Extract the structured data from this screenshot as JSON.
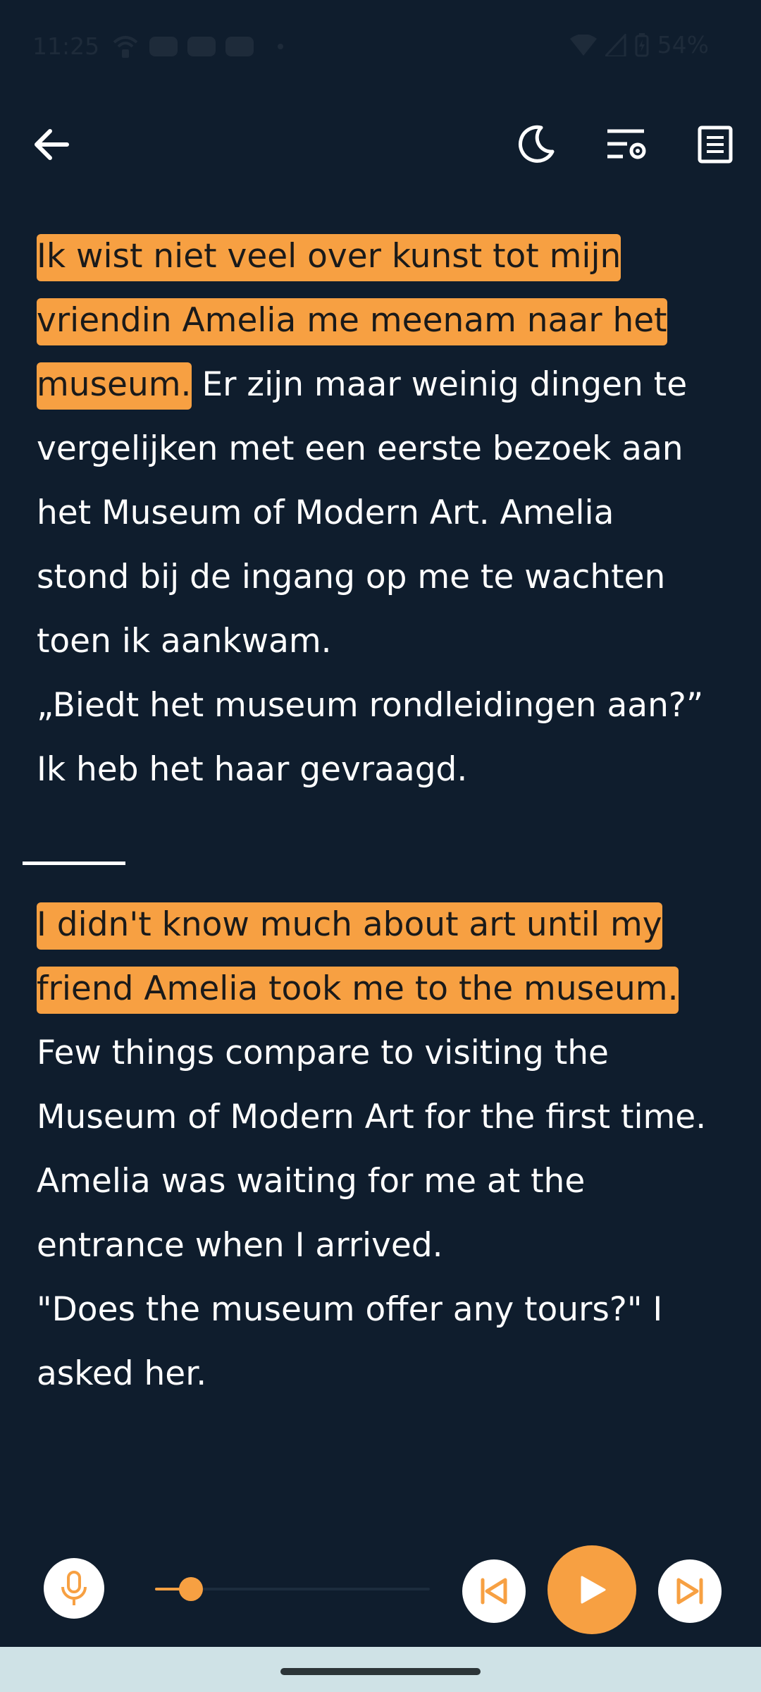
{
  "status_bar": {
    "time": "11:25",
    "battery": "54%",
    "icons": [
      "wifi-calling-icon",
      "youtube-icon",
      "youtube-icon",
      "youtube-icon",
      "notification-dot-icon",
      "wifi-icon",
      "signal-icon",
      "battery-icon"
    ]
  },
  "toolbar": {
    "icons": [
      "back-arrow-icon",
      "night-mode-moon-icon",
      "playback-settings-icon",
      "document-icon"
    ]
  },
  "text": {
    "dutch": {
      "highlighted": "Ik wist niet veel over kunst tot mijn vriendin Amelia me meenam naar het museum.",
      "rest": "Er zijn maar weinig dingen te vergelijken met een eerste bezoek aan het Museum of Modern Art.  Amelia stond bij de ingang op me te wachten toen ik aankwam.",
      "quote": "„Biedt het museum rondleidingen aan?” Ik heb het haar gevraagd."
    },
    "english": {
      "highlighted": "I didn't know much about art until my friend Amelia took me to the museum.",
      "rest": "Few things compare to visiting the Museum of Modern Art for the first time.  Amelia was waiting for me at the entrance when I arrived.",
      "quote": "\"Does the museum offer any tours?\" I asked her."
    }
  },
  "player": {
    "progress": 0.13,
    "icons": [
      "microphone-icon",
      "previous-sentence-icon",
      "play-icon",
      "next-sentence-icon"
    ]
  },
  "colors": {
    "background": "#0f1d2d",
    "accent": "#f7a042",
    "text": "#ffffff"
  }
}
